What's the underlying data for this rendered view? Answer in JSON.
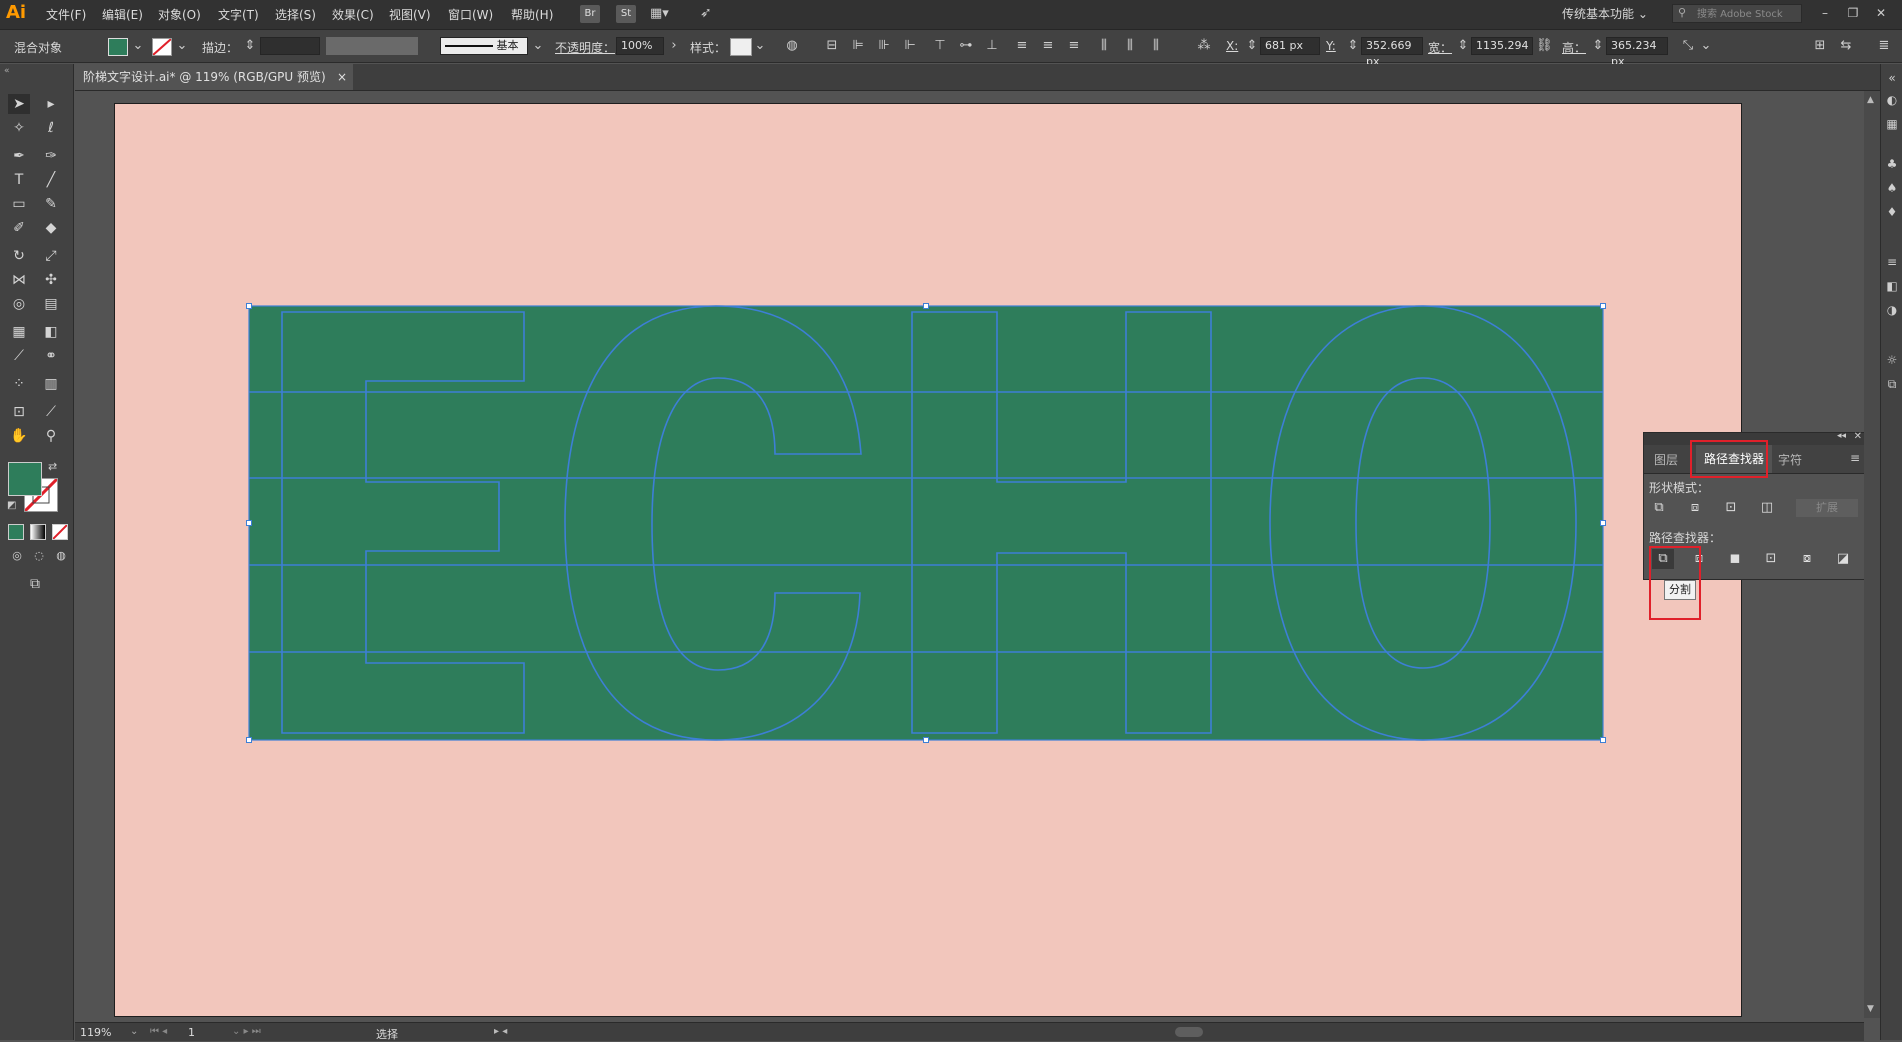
{
  "app": {
    "logo": "Ai",
    "brand_color": "#ff9a00"
  },
  "menu": [
    "文件(F)",
    "编辑(E)",
    "对象(O)",
    "文字(T)",
    "选择(S)",
    "效果(C)",
    "视图(V)",
    "窗口(W)",
    "帮助(H)"
  ],
  "bridge_buttons": [
    "Br",
    "St"
  ],
  "workspace": {
    "label": "传统基本功能"
  },
  "search": {
    "placeholder": "搜索 Adobe Stock"
  },
  "control": {
    "object_type": "混合对象",
    "stroke_label": "描边：",
    "stroke_style": "基本",
    "opacity_label": "不透明度：",
    "opacity_value": "100%",
    "style_label": "样式：",
    "x_label": "X:",
    "x_value": "681 px",
    "y_label": "Y:",
    "y_value": "352.669 px",
    "w_label": "宽：",
    "w_value": "1135.294",
    "h_label": "高：",
    "h_value": "365.234 px",
    "fill_color": "#2e7d5b"
  },
  "document": {
    "tab_title": "阶梯文字设计.ai* @ 119% (RGB/GPU 预览)",
    "close_glyph": "×"
  },
  "artboard": {
    "background": "#f2c6bc",
    "shape_fill": "#2e7d5b",
    "outline_color": "#3d7fd6",
    "text": "ECHO"
  },
  "panel": {
    "tabs": [
      "图层",
      "路径查找器",
      "字符"
    ],
    "active_tab": "路径查找器",
    "shape_modes_label": "形状模式：",
    "expand_label": "扩展",
    "pathfinders_label": "路径查找器：",
    "tooltip": "分割"
  },
  "status": {
    "zoom": "119%",
    "page": "1",
    "tool": "选择"
  },
  "highlight_color": "#e0202a"
}
